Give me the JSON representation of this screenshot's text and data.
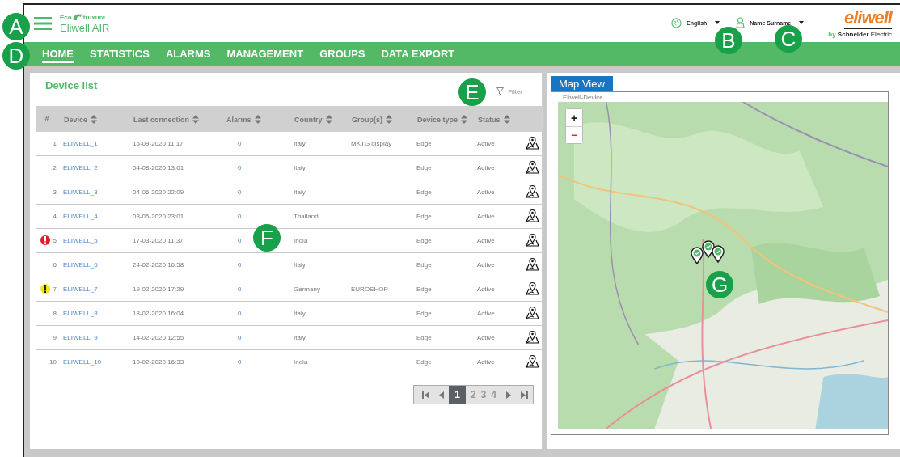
{
  "header": {
    "brand_top_left": "Eco",
    "brand_top_right": "truxure",
    "product": "Eliwell AIR",
    "language": "English",
    "user": "Name Surname",
    "logo": "eliwell",
    "logo_sub_bold": "Schneider",
    "logo_sub_prefix": "by",
    "logo_sub_suffix": "Electric"
  },
  "nav": [
    {
      "label": "HOME",
      "selected": true
    },
    {
      "label": "STATISTICS",
      "selected": false
    },
    {
      "label": "ALARMS",
      "selected": false
    },
    {
      "label": "MANAGEMENT",
      "selected": false
    },
    {
      "label": "GROUPS",
      "selected": false
    },
    {
      "label": "DATA EXPORT",
      "selected": false
    }
  ],
  "device_list": {
    "title": "Device list",
    "filter": "Filter",
    "columns": [
      "#",
      "Device",
      "Last connection",
      "Alarms",
      "Country",
      "Group(s)",
      "Device type",
      "Status"
    ],
    "rows": [
      {
        "number": "1",
        "device": "ELIWELL_1",
        "last_connection": "15-09-2020  11:17",
        "alarms": "0",
        "country": "Italy",
        "groups": "MKTG display",
        "device_type": "Edge",
        "status": "Active"
      },
      {
        "number": "2",
        "device": "ELIWELL_2",
        "last_connection": "04-08-2020  13:01",
        "alarms": "0",
        "country": "Italy",
        "device_type": "Edge",
        "status": "Active"
      },
      {
        "number": "3",
        "device": "ELIWELL_3",
        "last_connection": "04-06-2020  22:09",
        "alarms": "0",
        "country": "Italy",
        "device_type": "Edge",
        "status": "Active"
      },
      {
        "number": "4",
        "device": "ELIWELL_4",
        "last_connection": "03-05-2020  23:01",
        "alarms": "0",
        "country": "Thailand",
        "device_type": "Edge",
        "status": "Active"
      },
      {
        "number": "5",
        "kind": "error",
        "device": "ELIWELL_5",
        "last_connection": "17-03-2020  11:37",
        "alarms": "0",
        "country": "India",
        "device_type": "Edge",
        "status": "Active"
      },
      {
        "number": "6",
        "device": "ELIWELL_6",
        "last_connection": "24-02-2020  16:58",
        "alarms": "0",
        "country": "Italy",
        "device_type": "Edge",
        "status": "Active"
      },
      {
        "number": "7",
        "kind": "warning",
        "device": "ELIWELL_7",
        "last_connection": "19-02-2020  17:29",
        "alarms": "0",
        "country": "Germany",
        "groups": "EUROSHOP",
        "device_type": "Edge",
        "status": "Active"
      },
      {
        "number": "8",
        "device": "ELIWELL_8",
        "last_connection": "18-02-2020  16:04",
        "alarms": "0",
        "country": "Italy",
        "device_type": "Edge",
        "status": "Active"
      },
      {
        "number": "9",
        "device": "ELIWELL_9",
        "last_connection": "14-02-2020  12:55",
        "alarms": "0",
        "country": "Italy",
        "device_type": "Edge",
        "status": "Active"
      },
      {
        "number": "10",
        "device": "ELIWELL_10",
        "last_connection": "10-02-2020  16:33",
        "alarms": "0",
        "country": "India",
        "device_type": "Edge",
        "status": "Active"
      }
    ],
    "pagination": [
      {
        "label": "1",
        "selected": true
      },
      {
        "label": "2",
        "selected": false
      },
      {
        "label": "3",
        "selected": false
      },
      {
        "label": "4",
        "selected": false
      }
    ]
  },
  "map_view": {
    "tab": "Map View",
    "layer": "Eliwell-Device",
    "zoom_in": "+",
    "zoom_out": "−"
  },
  "callouts": [
    "A",
    "B",
    "C",
    "D",
    "E",
    "F",
    "G"
  ]
}
